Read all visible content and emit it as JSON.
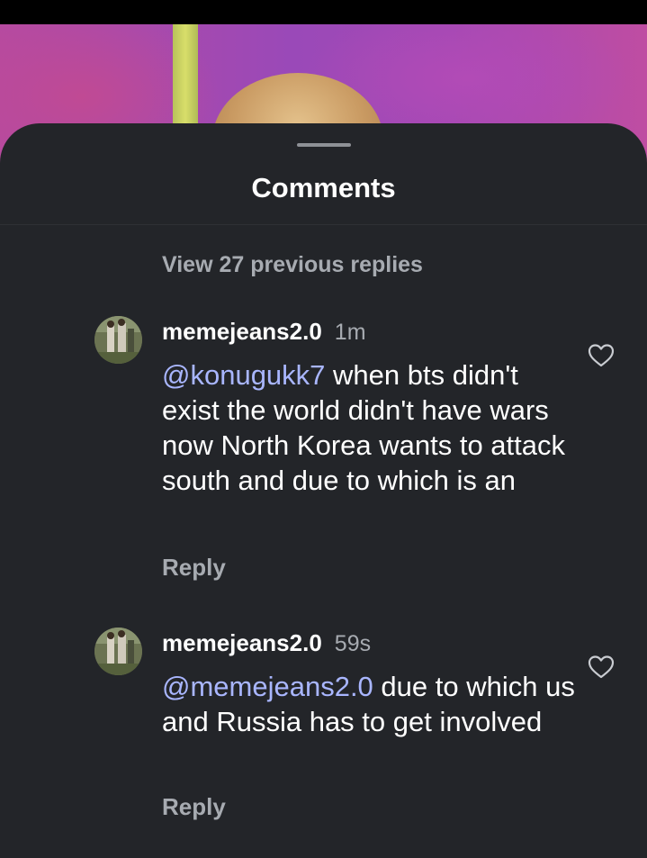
{
  "sheet": {
    "title": "Comments",
    "view_previous": "View 27 previous replies"
  },
  "comments": [
    {
      "username": "memejeans2.0",
      "time": "1m",
      "mention": "@konugukk7",
      "text": " when bts didn't exist the world didn't have wars now North Korea wants to attack south and due to which is an",
      "reply_label": "Reply",
      "like_icon": "heart-outline-icon"
    },
    {
      "username": "memejeans2.0",
      "time": "59s",
      "mention": "@memejeans2.0",
      "text": " due to which us and Russia has to get involved",
      "reply_label": "Reply",
      "like_icon": "heart-outline-icon"
    }
  ],
  "colors": {
    "sheet_background": "#232529",
    "mention": "#a9b6ff",
    "secondary_text": "#a7abb1"
  }
}
